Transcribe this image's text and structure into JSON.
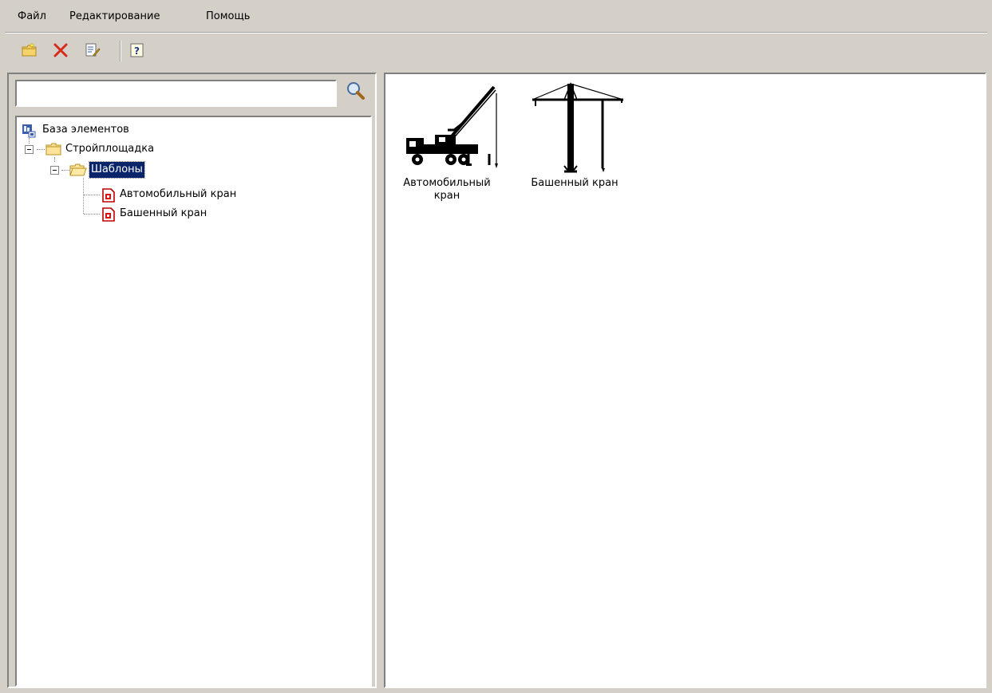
{
  "menu": {
    "file": "Файл",
    "edit": "Редактирование",
    "help": "Помощь"
  },
  "toolbar": {
    "buttons": [
      {
        "icon": "new-folder-icon"
      },
      {
        "icon": "delete-icon"
      },
      {
        "icon": "edit-properties-icon"
      },
      {
        "icon": "help-icon"
      }
    ]
  },
  "search": {
    "value": "",
    "icon": "search-icon"
  },
  "tree": {
    "root": {
      "label": "База элементов",
      "icon": "database-icon"
    },
    "folder1": {
      "label": "Стройплощадка",
      "icon": "folder-icon"
    },
    "folder2": {
      "label": "Шаблоны",
      "icon": "folder-open-icon",
      "selected": true
    },
    "items": [
      {
        "label": "Автомобильный кран",
        "icon": "template-icon"
      },
      {
        "label": "Башенный кран",
        "icon": "template-icon"
      }
    ]
  },
  "gallery": {
    "items": [
      {
        "line1": "Автомобильный",
        "line2": "кран",
        "icon": "mobile-crane-icon"
      },
      {
        "line1": "Башенный кран",
        "line2": "",
        "icon": "tower-crane-icon"
      }
    ]
  },
  "colors": {
    "window_bg": "#d4d0c8",
    "selection": "#0a246a"
  }
}
